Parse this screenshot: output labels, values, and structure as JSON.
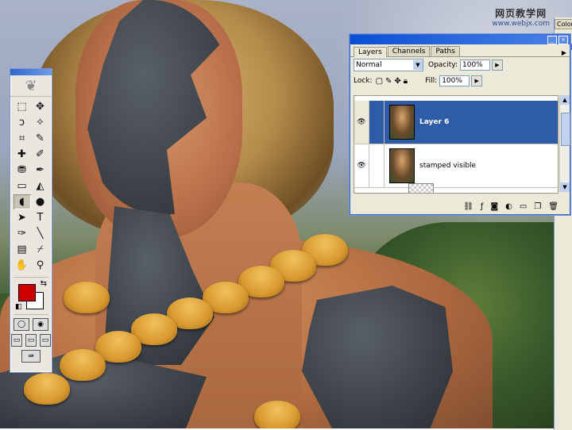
{
  "watermark": {
    "title": "网页教学网",
    "url": "www.webjx.com"
  },
  "toolbox": {
    "tools": [
      [
        "rect-marquee-icon",
        "⬚"
      ],
      [
        "move-icon",
        "✥"
      ],
      [
        "lasso-icon",
        "ↄ"
      ],
      [
        "magic-wand-icon",
        "✧"
      ],
      [
        "crop-icon",
        "⌗"
      ],
      [
        "slice-icon",
        "✎"
      ],
      [
        "healing-brush-icon",
        "✚"
      ],
      [
        "brush-icon",
        "✐"
      ],
      [
        "clone-stamp-icon",
        "⛃"
      ],
      [
        "history-brush-icon",
        "✒"
      ],
      [
        "eraser-icon",
        "▭"
      ],
      [
        "paint-bucket-icon",
        "◭"
      ],
      [
        "blur-icon",
        "◖"
      ],
      [
        "dodge-icon",
        "●"
      ],
      [
        "path-select-icon",
        "➤"
      ],
      [
        "type-icon",
        "T"
      ],
      [
        "pen-icon",
        "✑"
      ],
      [
        "line-icon",
        "╲"
      ],
      [
        "notes-icon",
        "▤"
      ],
      [
        "eyedropper-icon",
        "⌿"
      ],
      [
        "hand-icon",
        "✋"
      ],
      [
        "zoom-icon",
        "⚲"
      ]
    ],
    "active_tool_index": 12,
    "foreground_color": "#cc0000",
    "background_color": "#ffffff"
  },
  "layers_panel": {
    "tabs": [
      "Layers",
      "Channels",
      "Paths"
    ],
    "active_tab": "Layers",
    "blend_mode": "Normal",
    "opacity_label": "Opacity:",
    "opacity_value": "100%",
    "lock_label": "Lock:",
    "fill_label": "Fill:",
    "fill_value": "100%",
    "layers": [
      {
        "name": "Layer 6",
        "selected": true
      },
      {
        "name": "stamped visible",
        "selected": false
      }
    ],
    "footer_icons": [
      "link-icon",
      "style-icon",
      "mask-icon",
      "adjustment-icon",
      "group-icon",
      "new-layer-icon",
      "trash-icon"
    ]
  },
  "right_panel": {
    "tab_label": "Color"
  },
  "colors": {
    "accent_blue": "#2e5ca8",
    "title_bar": "#0a4fd4"
  }
}
